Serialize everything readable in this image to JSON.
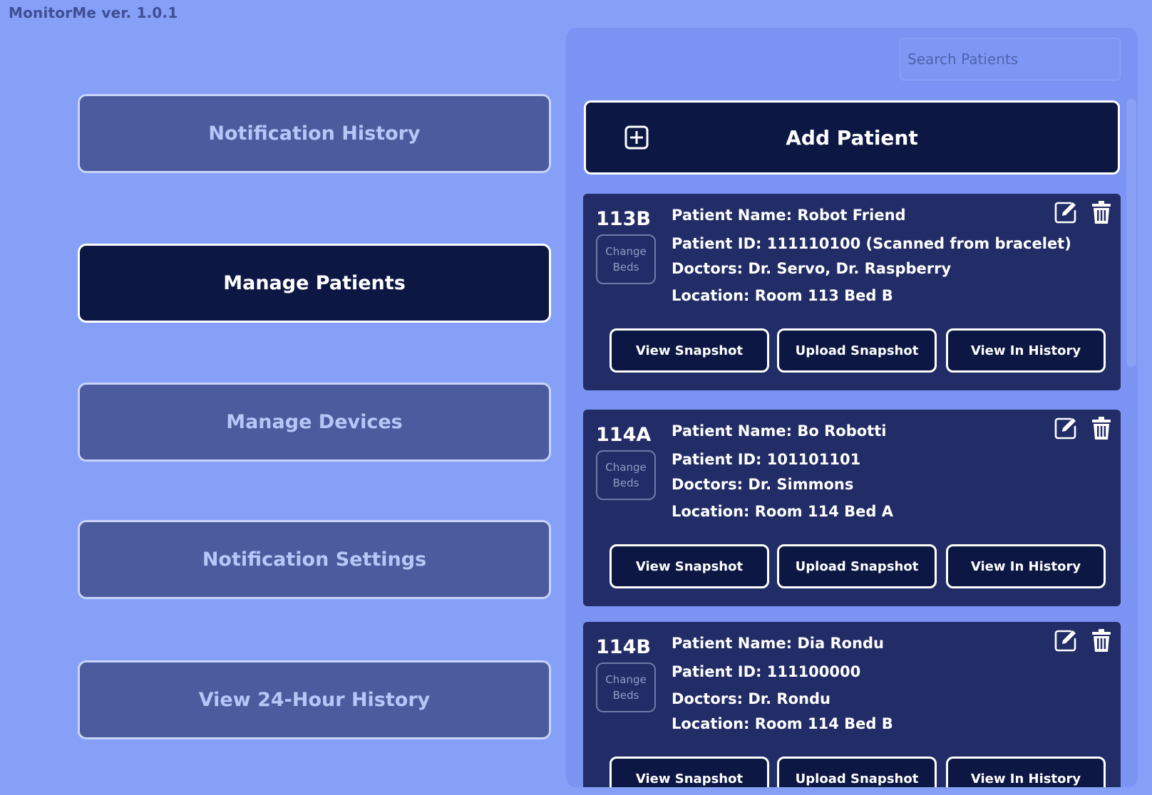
{
  "app": {
    "title": "MonitorMe ver. 1.0.1"
  },
  "nav": {
    "items": [
      {
        "label": "Notification History",
        "active": false
      },
      {
        "label": "Manage Patients",
        "active": true
      },
      {
        "label": "Manage Devices",
        "active": false
      },
      {
        "label": "Notification Settings",
        "active": false
      },
      {
        "label": "View 24-Hour History",
        "active": false
      }
    ]
  },
  "search": {
    "placeholder": "Search Patients",
    "value": ""
  },
  "add_patient": {
    "label": "Add Patient",
    "icon": "plus-square-icon"
  },
  "patients": [
    {
      "bed": "113B",
      "change_beds": "Change Beds",
      "name": "Patient Name: Robot Friend",
      "id": "Patient ID: 111110100 (Scanned from bracelet)",
      "doctors": "Doctors: Dr. Servo, Dr. Raspberry",
      "location": "Location: Room 113 Bed B",
      "actions": [
        "View Snapshot",
        "Upload Snapshot",
        "View In History"
      ]
    },
    {
      "bed": "114A",
      "change_beds": "Change Beds",
      "name": "Patient Name: Bo Robotti",
      "id": "Patient ID: 101101101",
      "doctors": "Doctors: Dr. Simmons",
      "location": "Location: Room 114 Bed A",
      "actions": [
        "View Snapshot",
        "Upload Snapshot",
        "View In History"
      ]
    },
    {
      "bed": "114B",
      "change_beds": "Change Beds",
      "name": "Patient Name: Dia Rondu",
      "id": "Patient ID: 111100000",
      "doctors": "Doctors: Dr. Rondu",
      "location": "Location: Room 114 Bed B",
      "actions": [
        "View Snapshot",
        "Upload Snapshot",
        "View In History"
      ]
    }
  ],
  "colors": {
    "background": "#86a0f7",
    "panel": "#7b93f2",
    "nav_inactive": "#4b5b9d",
    "nav_active": "#0c1744",
    "card": "#222c66",
    "button_dark": "#0c1744"
  },
  "icons": {
    "edit": "edit-pencil-icon",
    "delete": "trash-icon"
  }
}
